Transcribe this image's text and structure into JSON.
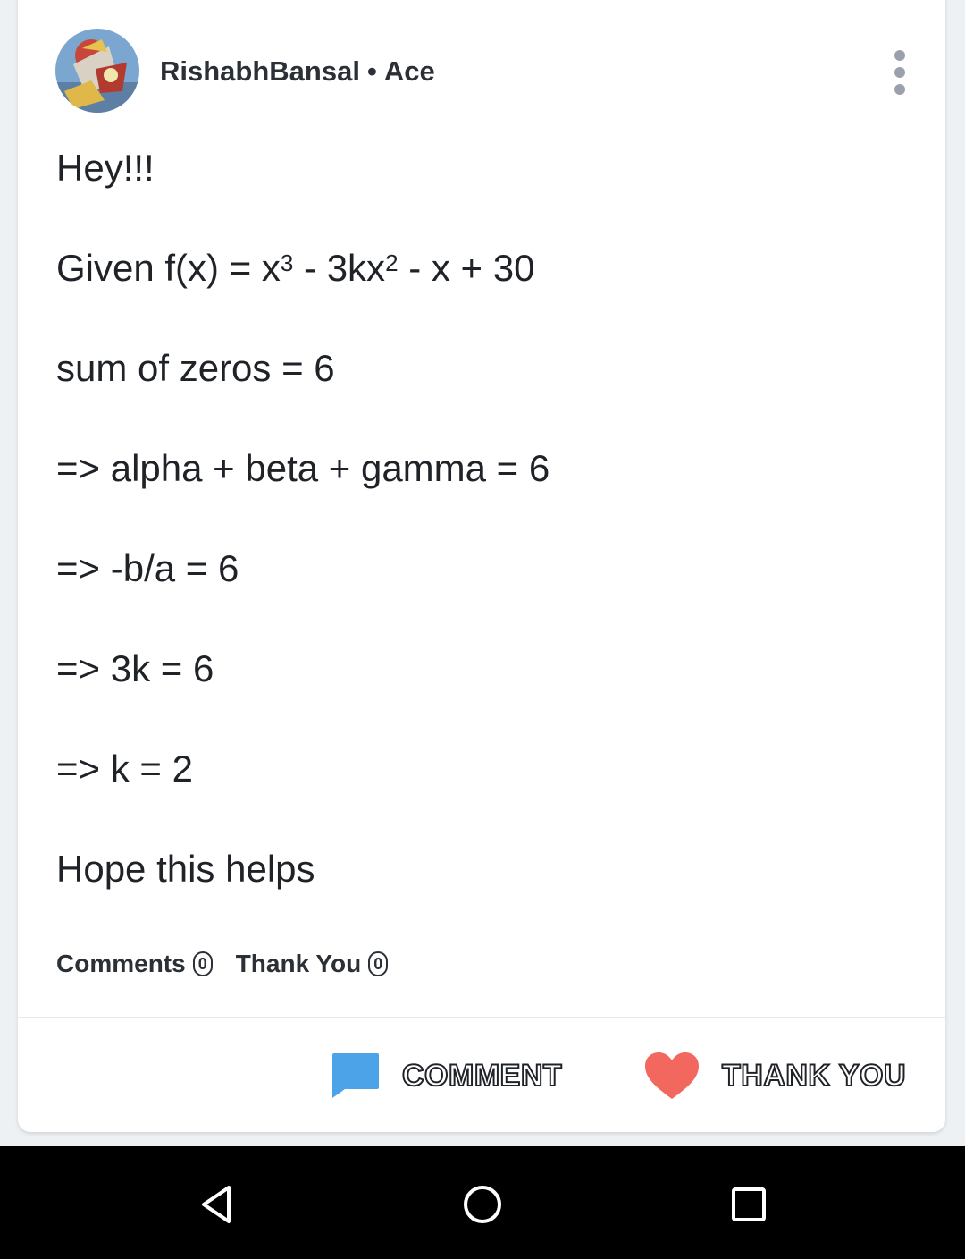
{
  "post": {
    "author": "RishabhBansal",
    "separator": "•",
    "rank": "Ace",
    "lines": {
      "l0": "Hey!!!",
      "l1_pre": "Given f(x) = x",
      "l1_sup1": "3",
      "l1_mid": " - 3kx",
      "l1_sup2": "2",
      "l1_post": " - x + 30",
      "l2": "sum of zeros = 6",
      "l3": "=> alpha + beta + gamma = 6",
      "l4": "=> -b/a = 6",
      "l5": "=> 3k = 6",
      "l6": "=> k = 2",
      "l7": "Hope this helps"
    },
    "stats": {
      "comments_label": "Comments",
      "comments_count": "0",
      "thanks_label": "Thank You",
      "thanks_count": "0"
    },
    "actions": {
      "comment_label": "COMMENT",
      "comment_icon": "speech-bubble-icon",
      "comment_color": "#4da3e8",
      "thank_label": "THANK YOU",
      "thank_icon": "heart-icon",
      "thank_color": "#f2685e"
    }
  },
  "system_nav": {
    "back_icon": "back-triangle-icon",
    "home_icon": "home-circle-icon",
    "recents_icon": "recents-square-icon"
  }
}
